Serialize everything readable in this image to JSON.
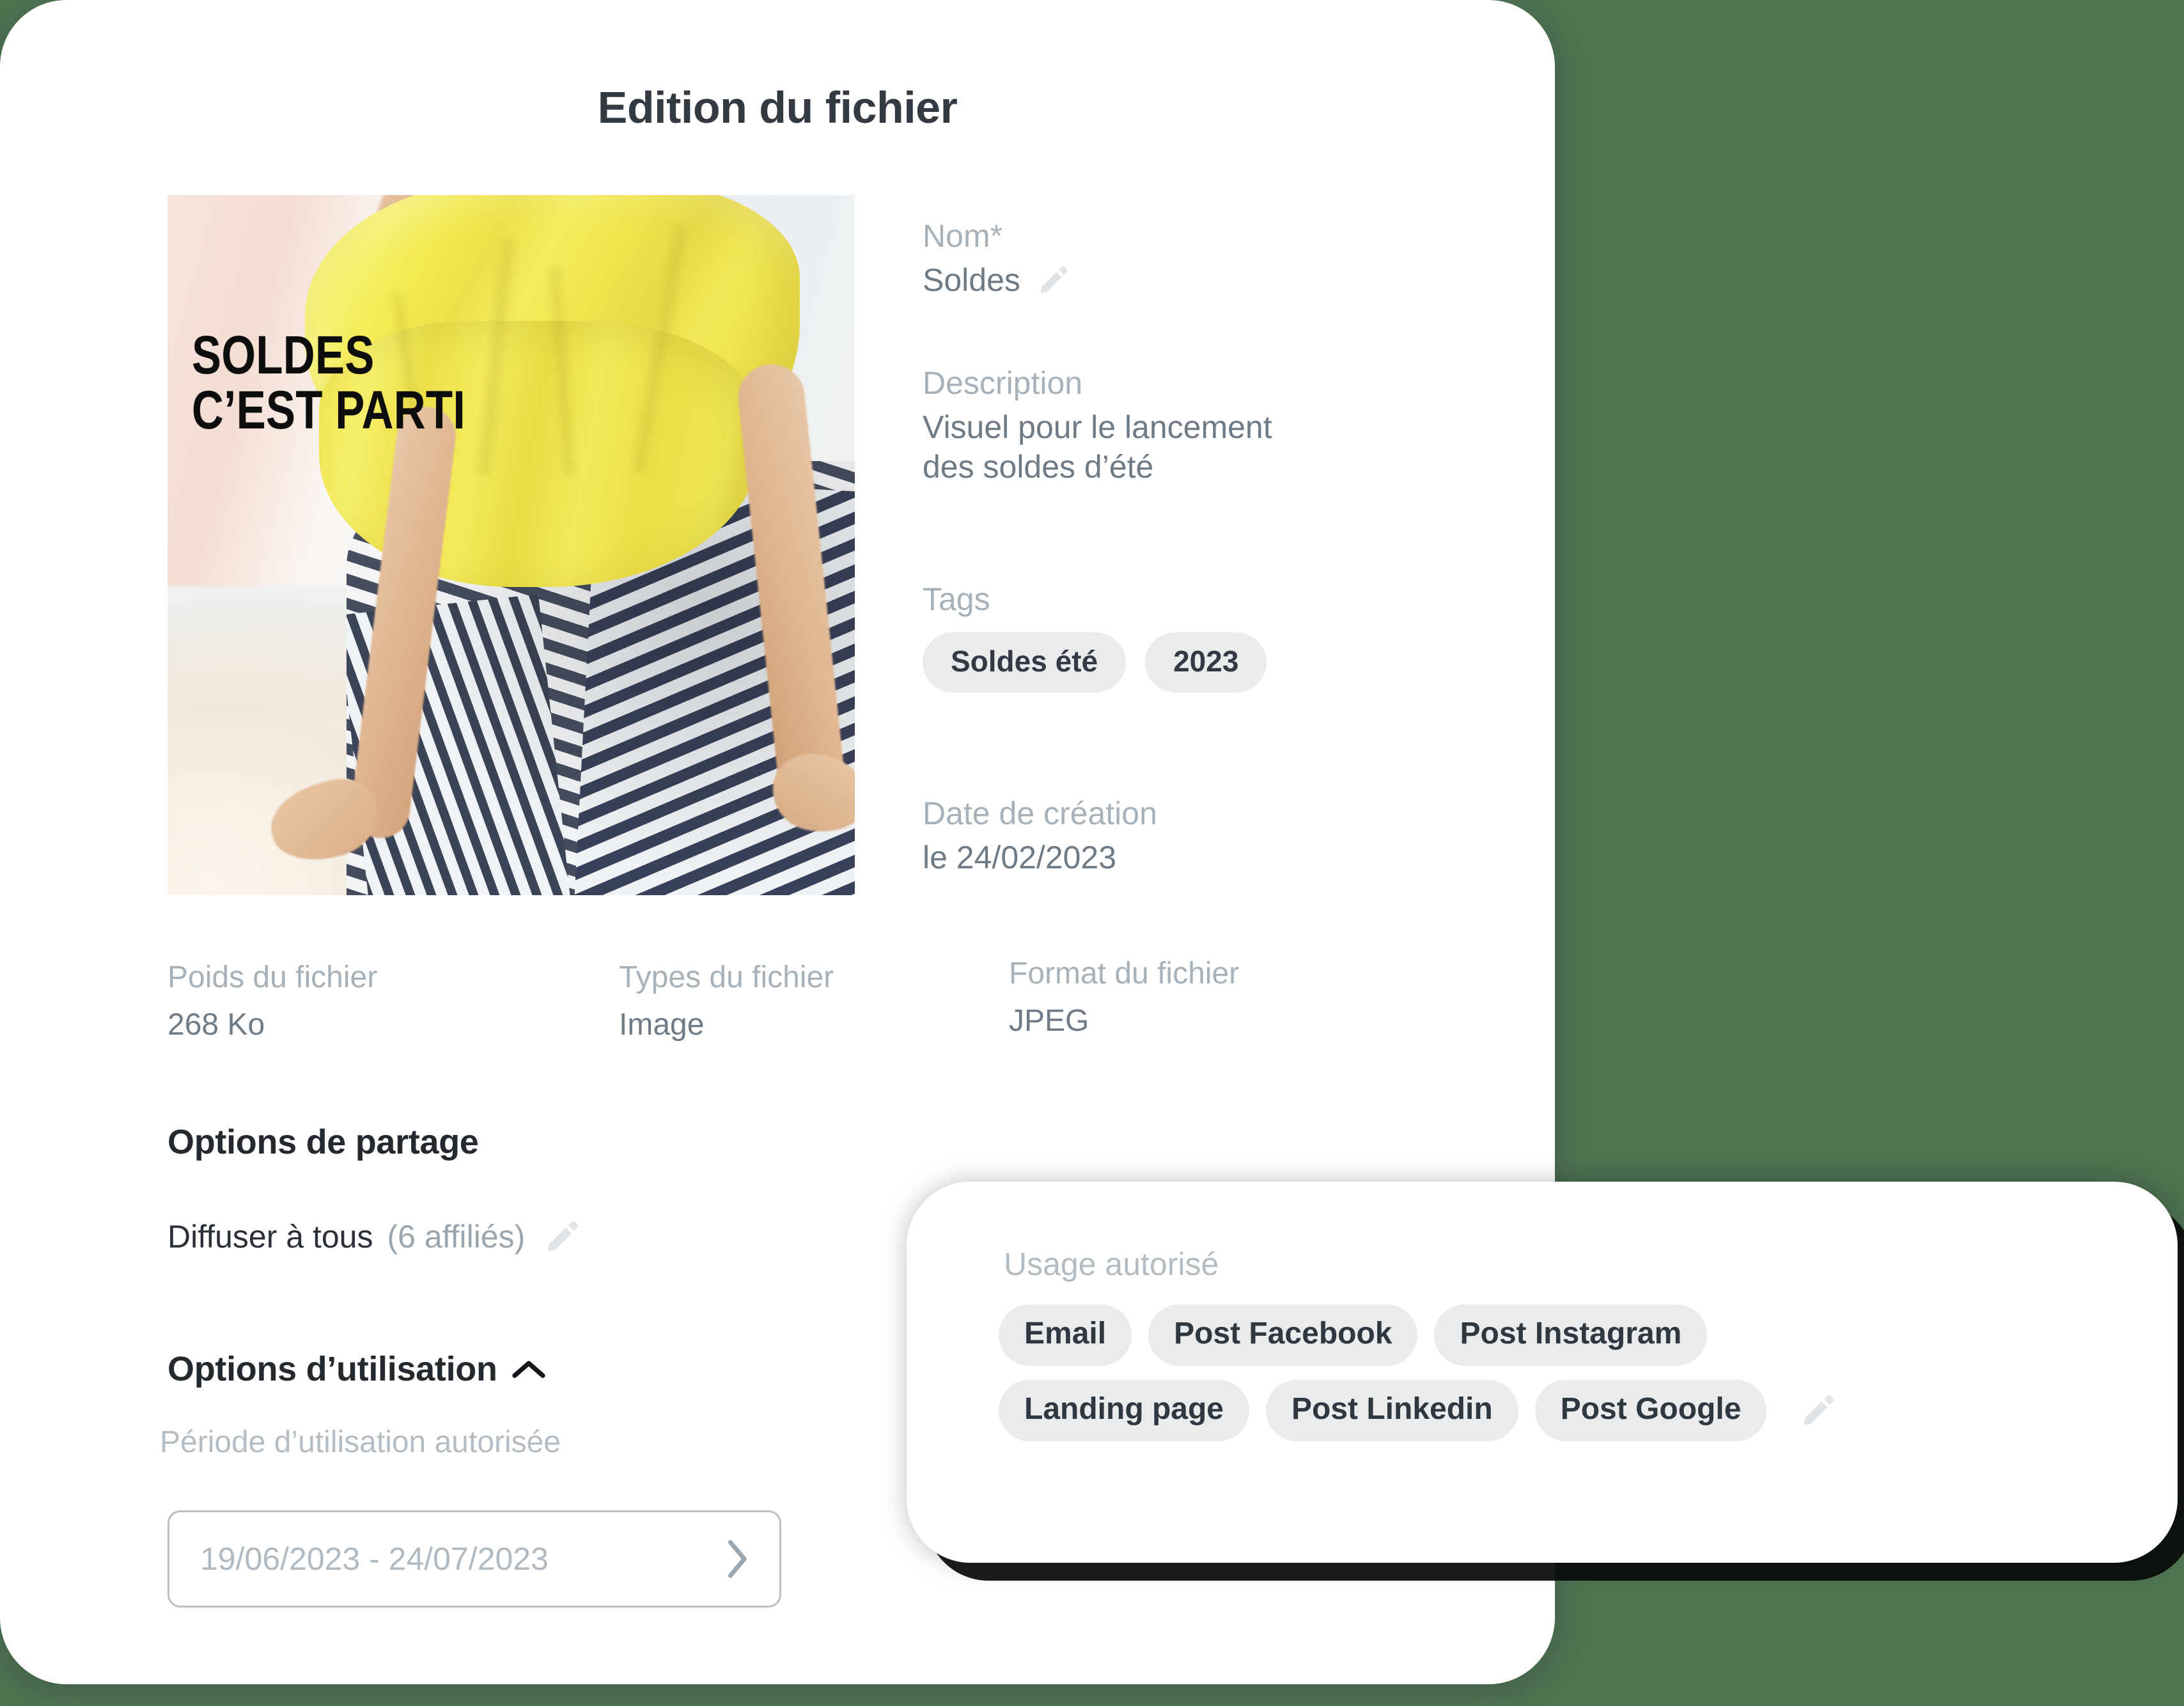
{
  "background_color": "#4d7350",
  "main_card": {
    "title": "Edition du fichier"
  },
  "preview": {
    "overlay_text": "SOLDES\nC’EST PARTI",
    "alt": "Femme en haut jaune et jupe rayée assise"
  },
  "details": {
    "name_label": "Nom*",
    "name_value": "Soldes",
    "description_label": "Description",
    "description_value": "Visuel pour le lancement des soldes d’été",
    "tags_label": "Tags",
    "tags": [
      "Soldes été",
      "2023"
    ],
    "creation_date_label": "Date de création",
    "creation_date_value": "le 24/02/2023"
  },
  "file_info": {
    "weight_label": "Poids du fichier",
    "weight_value": "268 Ko",
    "type_label": "Types du fichier",
    "type_value": "Image",
    "format_label": "Format du fichier",
    "format_value": "JPEG"
  },
  "sharing": {
    "section_title": "Options de partage",
    "diffuse_label": "Diffuser à tous",
    "diffuse_count": "(6 affiliés)"
  },
  "usage_options": {
    "section_title": "Options d’utilisation",
    "period_label": "Période d’utilisation autorisée",
    "date_range_value": "19/06/2023 - 24/07/2023"
  },
  "usage_card": {
    "label": "Usage autorisé",
    "row1": [
      "Email",
      "Post Facebook",
      "Post Instagram"
    ],
    "row2": [
      "Landing page",
      "Post Linkedin",
      "Post Google"
    ]
  },
  "colors": {
    "background_green": "#4d7350",
    "title_slate": "#343a42",
    "muted_label": "#a7b1b9",
    "value_gray": "#6e7a85",
    "pill_bg": "#e9ebed",
    "pill_text": "#333a45",
    "pencil_gray": "#dfe3e5"
  }
}
